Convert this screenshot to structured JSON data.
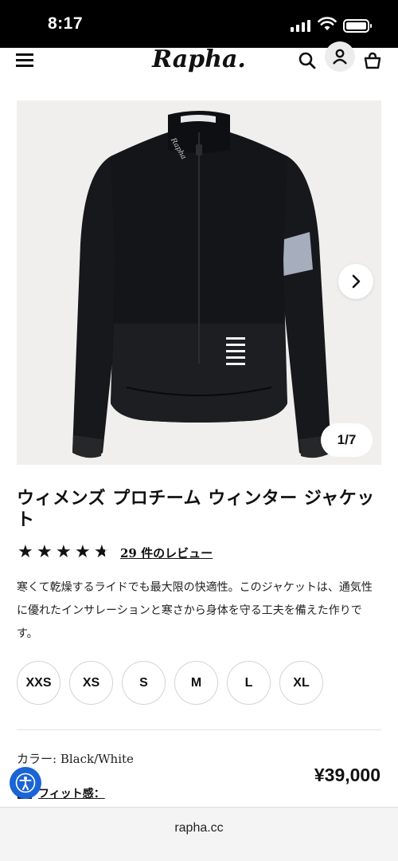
{
  "status_bar": {
    "time": "8:17"
  },
  "header": {
    "logo": "Rapha."
  },
  "gallery": {
    "counter": "1/7"
  },
  "product": {
    "title": "ウィメンズ プロチーム ウィンター ジャケット",
    "rating": 4.5,
    "reviews_link": "29 件のレビュー",
    "description": "寒くて乾燥するライドでも最大限の快適性。このジャケットは、通気性に優れたインサレーションと寒さから身体を守る工夫を備えた作りです。",
    "sizes": [
      "XXS",
      "XS",
      "S",
      "M",
      "L",
      "XL"
    ],
    "color_line": "カラー: Black/White",
    "price": "¥39,000",
    "fit_link": "フィット感："
  },
  "browser": {
    "url": "rapha.cc"
  },
  "colors": {
    "accessibility_blue": "#1a64d6",
    "jacket": "#16171b",
    "armband": "#a6adbd"
  }
}
